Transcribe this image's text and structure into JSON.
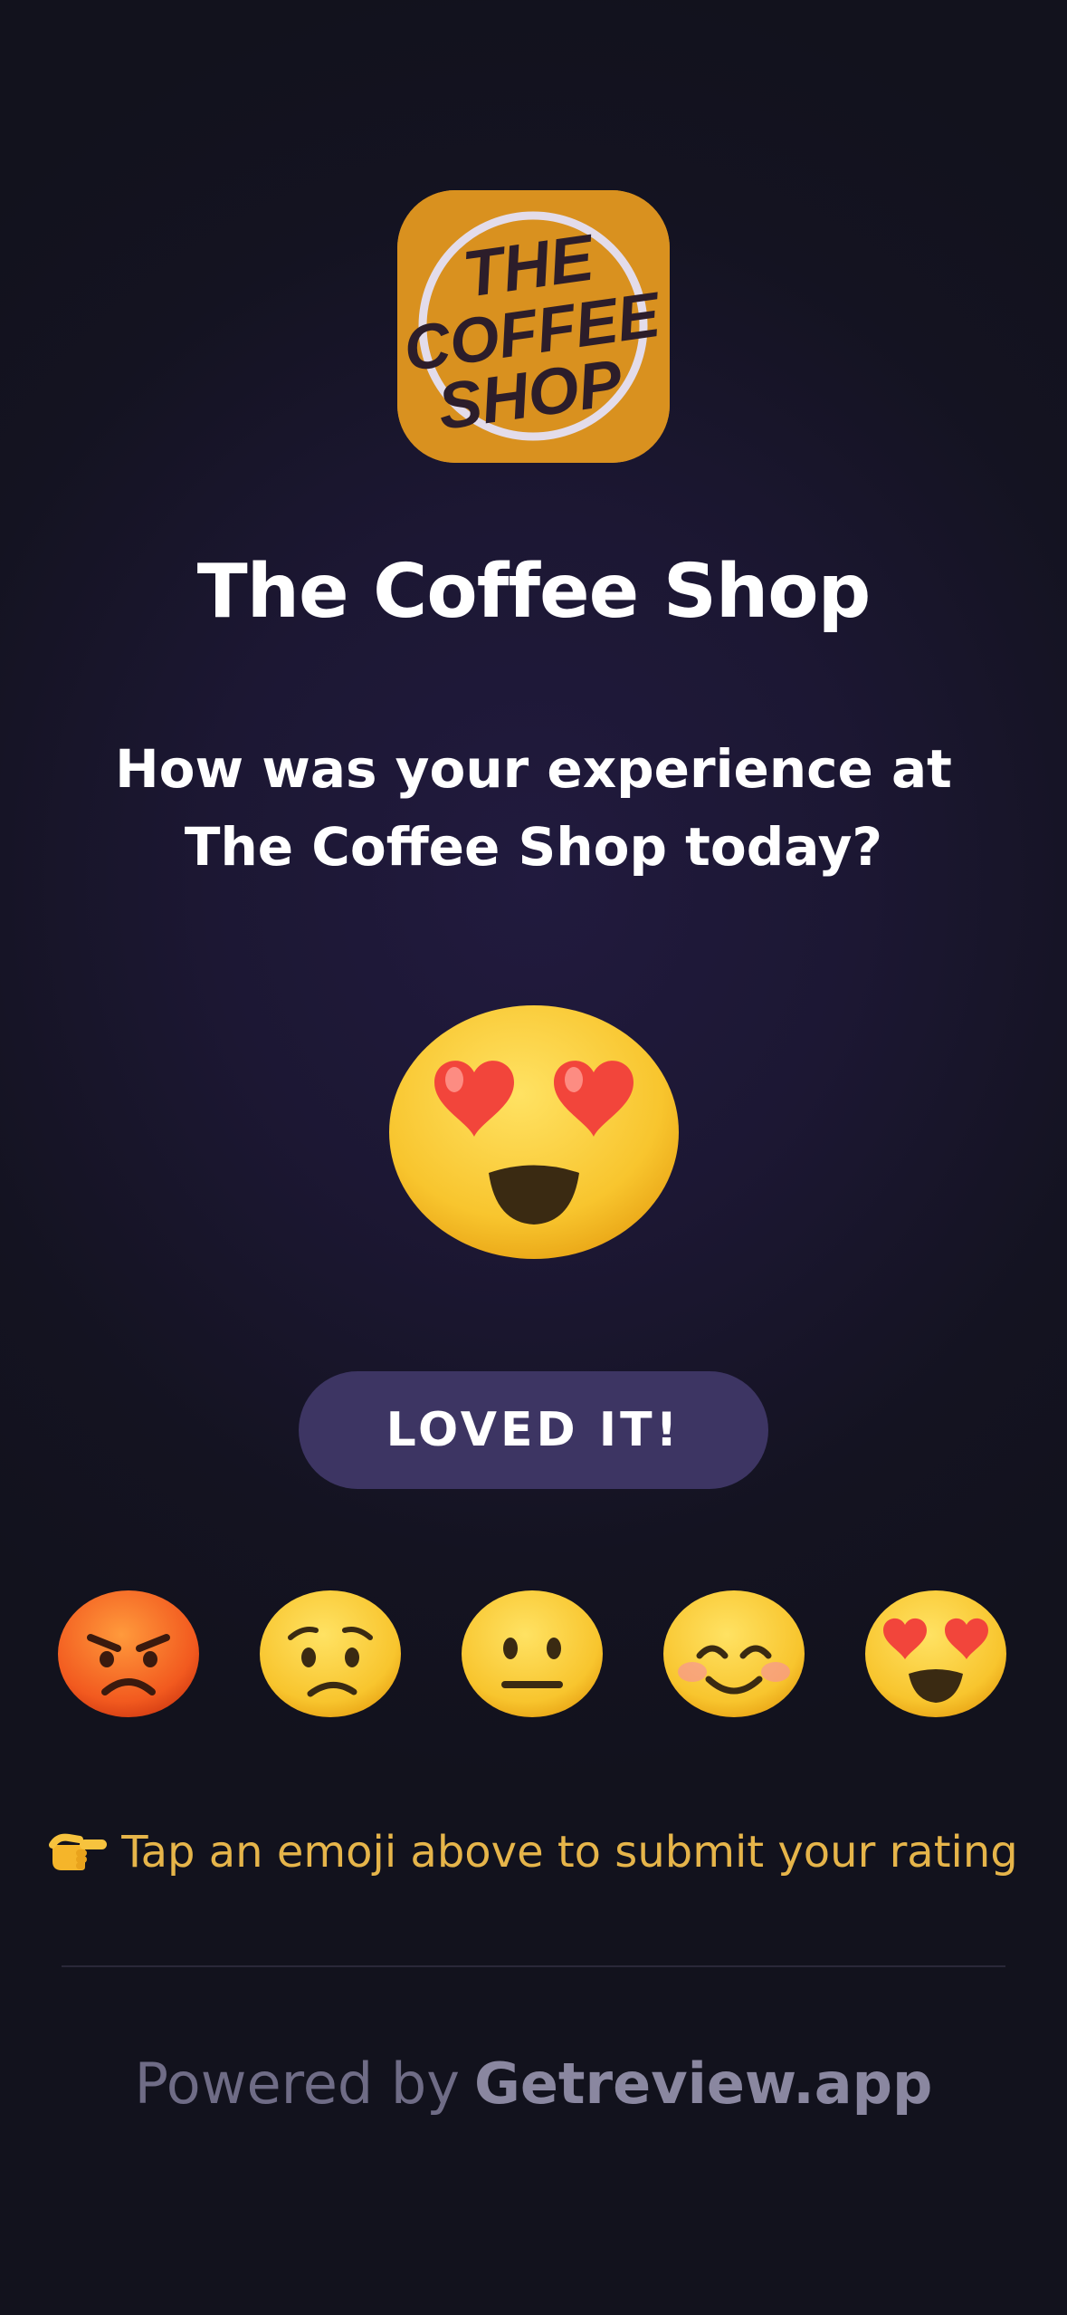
{
  "shop": {
    "name": "The Coffee Shop",
    "logo_text": [
      "THE",
      "COFFEE",
      "SHOP"
    ]
  },
  "question": "How was your experience at The Coffee Shop today?",
  "selected_rating": {
    "label": "LOVED IT!",
    "icon": "heart-eyes-face-icon"
  },
  "rating_options": [
    {
      "icon": "angry-face-icon"
    },
    {
      "icon": "worried-face-icon"
    },
    {
      "icon": "neutral-face-icon"
    },
    {
      "icon": "smiling-face-icon"
    },
    {
      "icon": "heart-eyes-face-icon"
    }
  ],
  "hint": {
    "icon": "pointing-hand-icon",
    "text": "Tap an emoji above to submit your rating"
  },
  "footer": {
    "prefix": "Powered by",
    "brand": "Getreview.app"
  },
  "colors": {
    "background": "#14131f",
    "pill": "#3d3563",
    "hint": "#e6b54a",
    "logo": "#d9911f"
  }
}
